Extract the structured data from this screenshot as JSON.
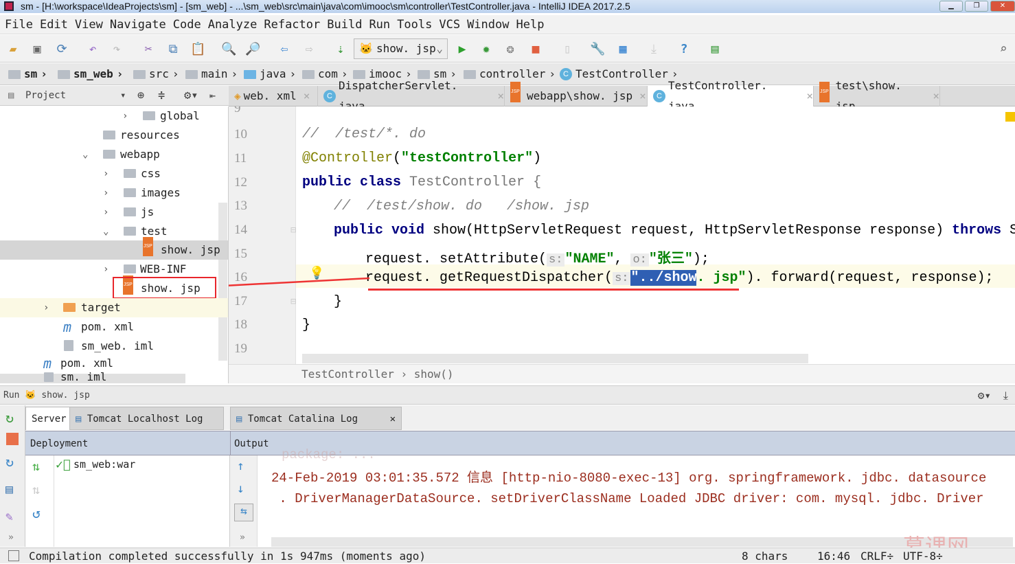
{
  "window": {
    "title": "sm - [H:\\workspace\\IdeaProjects\\sm] - [sm_web] - ...\\sm_web\\src\\main\\java\\com\\imooc\\sm\\controller\\TestController.java - IntelliJ IDEA 2017.2.5"
  },
  "menu": [
    "File",
    "Edit",
    "View",
    "Navigate",
    "Code",
    "Analyze",
    "Refactor",
    "Build",
    "Run",
    "Tools",
    "VCS",
    "Window",
    "Help"
  ],
  "toolbar": {
    "run_config": "show. jsp"
  },
  "breadcrumb": [
    "sm",
    "sm_web",
    "src",
    "main",
    "java",
    "com",
    "imooc",
    "sm",
    "controller",
    "TestController"
  ],
  "project_panel": {
    "title": "Project"
  },
  "tabs": [
    {
      "label": "web. xml",
      "icon": "xml"
    },
    {
      "label": "DispatcherServlet. java",
      "icon": "class"
    },
    {
      "label": "webapp\\show. jsp",
      "icon": "jsp"
    },
    {
      "label": "TestController. java",
      "icon": "class",
      "active": true
    },
    {
      "label": "test\\show. jsp",
      "icon": "jsp"
    }
  ],
  "tree": [
    {
      "label": "global",
      "type": "folder"
    },
    {
      "label": "resources",
      "type": "folder"
    },
    {
      "label": "webapp",
      "type": "folder"
    },
    {
      "label": "css",
      "type": "folder"
    },
    {
      "label": "images",
      "type": "folder"
    },
    {
      "label": "js",
      "type": "folder"
    },
    {
      "label": "test",
      "type": "folder"
    },
    {
      "label": "show. jsp",
      "type": "jsp",
      "selected": true
    },
    {
      "label": "WEB-INF",
      "type": "folder"
    },
    {
      "label": "show. jsp",
      "type": "jsp",
      "annotated": true
    },
    {
      "label": "target",
      "type": "folder"
    },
    {
      "label": "pom. xml",
      "type": "maven"
    },
    {
      "label": "sm_web. iml",
      "type": "iml"
    },
    {
      "label": "pom. xml",
      "type": "maven"
    },
    {
      "label": "sm. iml",
      "type": "iml"
    }
  ],
  "editor": {
    "line_numbers": [
      "9",
      "10",
      "11",
      "12",
      "13",
      "14",
      "15",
      "16",
      "17",
      "18",
      "19"
    ],
    "lines": {
      "l10": "//  /test/*. do",
      "l11a": "@Controller",
      "l11b": "(",
      "l11c": "\"testController\"",
      "l11d": ")",
      "l12a": "public class",
      "l12b": " TestController {",
      "l13": "//  /test/show. do   /show. jsp",
      "l14a": "public void",
      "l14b": " show(HttpServletRequest request, HttpServletResponse response) ",
      "l14c": "throws",
      "l14d": " Se",
      "l15a": "request. setAttribute(",
      "l15h1": "s:",
      "l15b": "\"NAME\"",
      ", ": ", ",
      "l15h2": "o:",
      "l15c": "\"张三\"",
      "l15d": ");",
      "l16a": "request. getRequestDispatcher(",
      "l16h": "s:",
      "l16sel": "\"../show",
      "l16b": ". jsp\"",
      "l16c": "). forward(request, response);",
      "l17": "}",
      "l18": "}"
    },
    "crumb": [
      "TestController",
      "show()"
    ],
    "accent_underline": "#ee3333"
  },
  "run": {
    "label": "Run",
    "config": "show. jsp"
  },
  "bottom_tabs": [
    "Server",
    "Tomcat Localhost Log",
    "Tomcat Catalina Log"
  ],
  "columns": {
    "deployment": "Deployment",
    "output": "Output"
  },
  "deployment": [
    "sm_web:war"
  ],
  "output": [
    "24-Feb-2019 03:01:35.572 信息 [http-nio-8080-exec-13] org. springframework. jdbc. datasource",
    " . DriverManagerDataSource. setDriverClassName Loaded JDBC driver: com. mysql. jdbc. Driver"
  ],
  "status": {
    "message": "Compilation completed successfully in 1s 947ms (moments ago)",
    "chars": "8 chars",
    "position": "16:46",
    "line_sep": "CRLF÷",
    "encoding": "UTF-8÷"
  },
  "watermark": "慕课网"
}
